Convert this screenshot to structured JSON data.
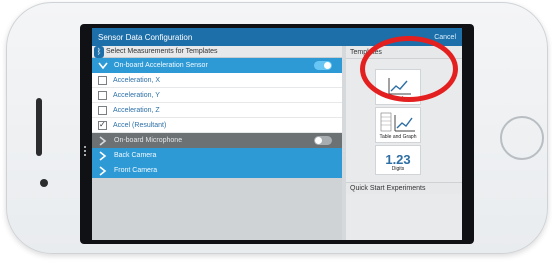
{
  "window": {
    "title": "Sensor Data Configuration",
    "cancel_label": "Cancel"
  },
  "left_panel": {
    "header": "Select Measurements for Templates",
    "sections": [
      {
        "title": "On-board Acceleration Sensor",
        "expanded": true,
        "toggle_on": true,
        "items": [
          {
            "label": "Acceleration, X",
            "checked": false
          },
          {
            "label": "Acceleration, Y",
            "checked": false
          },
          {
            "label": "Acceleration, Z",
            "checked": false
          },
          {
            "label": "Accel (Resultant)",
            "checked": true
          }
        ]
      },
      {
        "title": "On-board Microphone",
        "expanded": false,
        "toggle_on": false
      },
      {
        "title": "Back Camera",
        "expanded": false
      },
      {
        "title": "Front Camera",
        "expanded": false
      }
    ]
  },
  "right_panel": {
    "templates_header": "Templates",
    "tiles": [
      {
        "caption": "Graph"
      },
      {
        "caption": "Table and Graph"
      },
      {
        "caption": "Digits",
        "value": "1.23"
      }
    ],
    "quick_start_header": "Quick Start Experiments"
  },
  "colors": {
    "title_bar": "#1d6faa",
    "section_blue": "#2d9ad6",
    "section_gray": "#6c7174",
    "annotation_red": "#e31f1f"
  }
}
